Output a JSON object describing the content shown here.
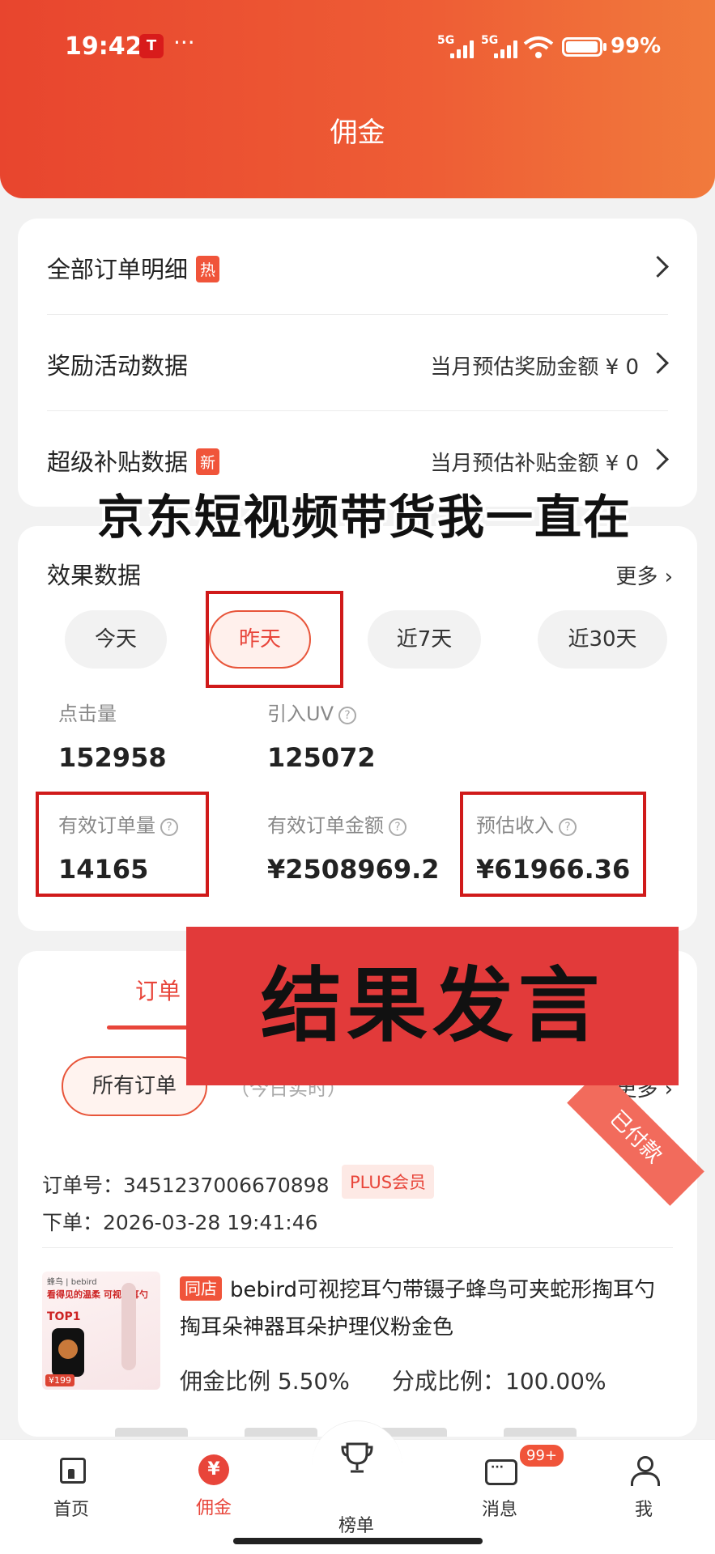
{
  "status": {
    "time": "19:42",
    "network1": "5G",
    "network2": "5G",
    "battery": "99%"
  },
  "header": {
    "title": "佣金"
  },
  "menu": [
    {
      "label": "全部订单明细",
      "tag": "热",
      "right": ""
    },
    {
      "label": "奖励活动数据",
      "tag": "",
      "right": "当月预估奖励金额 ¥ 0"
    },
    {
      "label": "超级补贴数据",
      "tag": "新",
      "right": "当月预估补贴金额 ¥ 0"
    }
  ],
  "overlay_text": "京东短视频带货我一直在",
  "effect": {
    "title": "效果数据",
    "more": "更多 ›",
    "tabs": [
      "今天",
      "昨天",
      "近7天",
      "近30天"
    ],
    "active_tab": "昨天",
    "metrics": [
      {
        "label": "点击量",
        "value": "152958",
        "help": false
      },
      {
        "label": "引入UV",
        "value": "125072",
        "help": true
      },
      {
        "label": "有效订单量",
        "value": "14165",
        "help": true
      },
      {
        "label": "有效订单金额",
        "value": "¥2508969.2",
        "help": true
      },
      {
        "label": "预估收入",
        "value": "¥61966.36",
        "help": true
      }
    ]
  },
  "result_banner": "结果发言",
  "orders": {
    "tab": "订单",
    "filter": "所有订单",
    "hint": "（今日实时）",
    "more": "更多 ›",
    "order_no": "订单号：3451237006670898",
    "plus_badge": "PLUS会员",
    "status": "已付款",
    "order_time": "下单：2026-03-28 19:41:46",
    "product": {
      "store_tag": "同店",
      "title": "bebird可视挖耳勺带镊子蜂鸟可夹蛇形掏耳勺掏耳朵神器耳朵护理仪粉金色",
      "commission": "佣金比例 5.50%",
      "share": "分成比例：100.00%",
      "image_brand": "蜂鸟 | bebird",
      "image_line": "看得见的温柔 可视挖耳勺",
      "image_top": "TOP1",
      "image_price": "¥199"
    }
  },
  "nav": [
    {
      "label": "首页",
      "icon": "home-icon"
    },
    {
      "label": "佣金",
      "icon": "yen-icon"
    },
    {
      "label": "榜单",
      "icon": "trophy-icon"
    },
    {
      "label": "消息",
      "icon": "message-icon",
      "badge": "99+"
    },
    {
      "label": "我",
      "icon": "person-icon"
    }
  ],
  "colors": {
    "accent": "#e8453a",
    "header_start": "#e8452e",
    "header_end": "#f17a3c",
    "annotation_box": "#d01a1a",
    "banner_bg": "#e23a3a"
  }
}
